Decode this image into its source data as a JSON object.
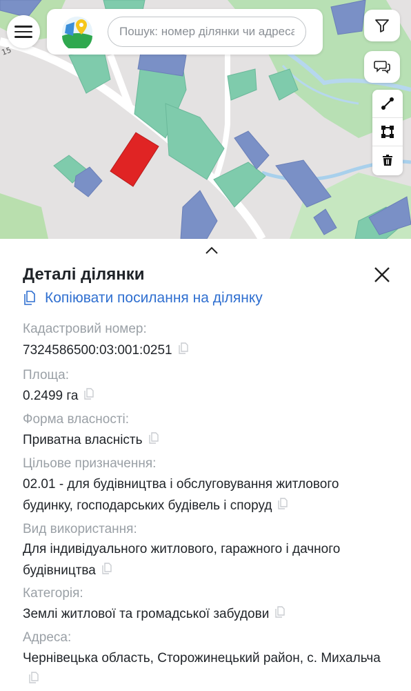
{
  "search": {
    "placeholder": "Пошук: номер ділянки чи адреса"
  },
  "map": {
    "road_label": "15"
  },
  "panel": {
    "title": "Деталі ділянки",
    "copy_link_label": "Копіювати посилання на ділянку",
    "fields": [
      {
        "label": "Кадастровий номер:",
        "value": "7324586500:03:001:0251"
      },
      {
        "label": "Площа:",
        "value": "0.2499 га"
      },
      {
        "label": "Форма власності:",
        "value": "Приватна власність"
      },
      {
        "label": "Цільове призначення:",
        "value": "02.01 - для будівництва і обслуговування житлового будинку, господарських будівель і споруд"
      },
      {
        "label": "Вид використання:",
        "value": "Для індивідуального житлового, гаражного і дачного будівництва"
      },
      {
        "label": "Категорія:",
        "value": "Землі житлової та громадської забудови"
      },
      {
        "label": "Адреса:",
        "value": "Чернівецька область, Сторожинецький район, с. Михальча"
      }
    ]
  },
  "colors": {
    "accent": "#2f6fd0",
    "selected_parcel": "#e02424",
    "parcel_green": "#7fcbac",
    "parcel_blue": "#7a90c6"
  }
}
